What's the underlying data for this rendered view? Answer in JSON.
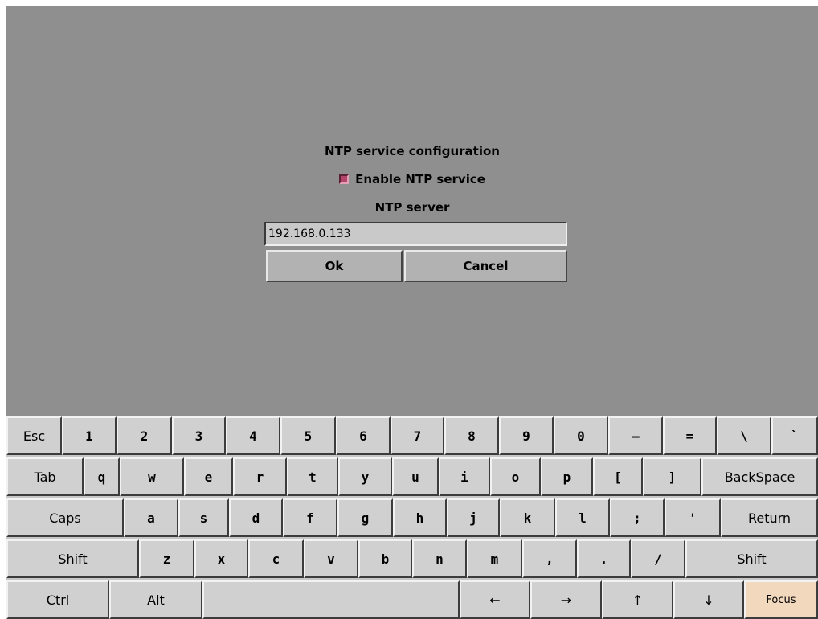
{
  "dialog": {
    "title": "NTP service configuration",
    "enable_label": "Enable NTP service",
    "enable_checked": true,
    "server_label": "NTP server",
    "server_value": "192.168.0.133",
    "ok_label": "Ok",
    "cancel_label": "Cancel"
  },
  "keyboard": {
    "row1": [
      "Esc",
      "1",
      "2",
      "3",
      "4",
      "5",
      "6",
      "7",
      "8",
      "9",
      "0",
      "–",
      "=",
      "\\",
      "`"
    ],
    "row2": [
      "Tab",
      "q",
      "w",
      "e",
      "r",
      "t",
      "y",
      "u",
      "i",
      "o",
      "p",
      "[",
      "]",
      "BackSpace"
    ],
    "row3": [
      "Caps",
      "a",
      "s",
      "d",
      "f",
      "g",
      "h",
      "j",
      "k",
      "l",
      ";",
      "'",
      "Return"
    ],
    "row4": [
      "Shift",
      "z",
      "x",
      "c",
      "v",
      "b",
      "n",
      "m",
      ",",
      ".",
      "/",
      "Shift"
    ],
    "row5": [
      "Ctrl",
      "Alt",
      "",
      "←",
      "→",
      "↑",
      "↓",
      "Focus"
    ]
  },
  "colors": {
    "background": "#8f8f8f",
    "checkbox": "#b3446a",
    "focus_key": "#f2d8bd"
  }
}
